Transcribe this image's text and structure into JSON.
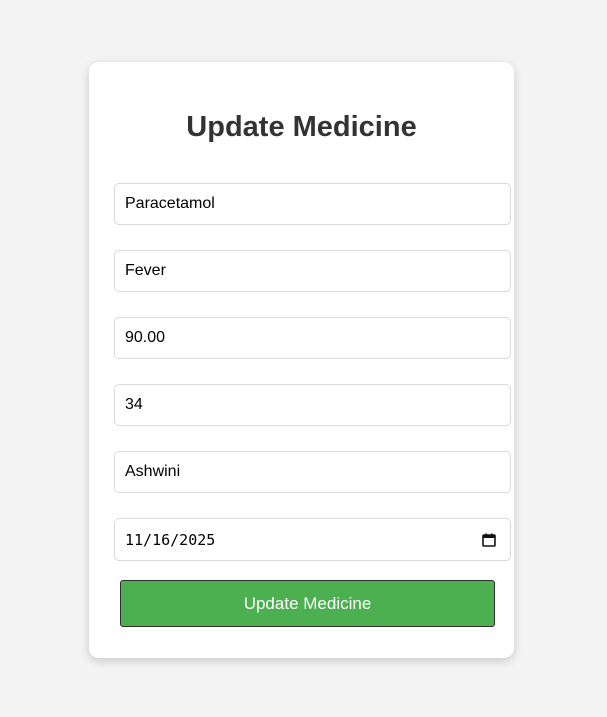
{
  "form": {
    "title": "Update Medicine",
    "fields": {
      "name": "Paracetamol",
      "purpose": "Fever",
      "price": "90.00",
      "quantity": "34",
      "manufacturer": "Ashwini",
      "expiry_date": "11/16/2025"
    },
    "submit_label": "Update Medicine"
  },
  "colors": {
    "page_background": "#f4f4f4",
    "card_background": "#ffffff",
    "button_background": "#4caf50",
    "title_color": "#333333"
  },
  "icons": {
    "date_picker": "calendar-icon"
  }
}
